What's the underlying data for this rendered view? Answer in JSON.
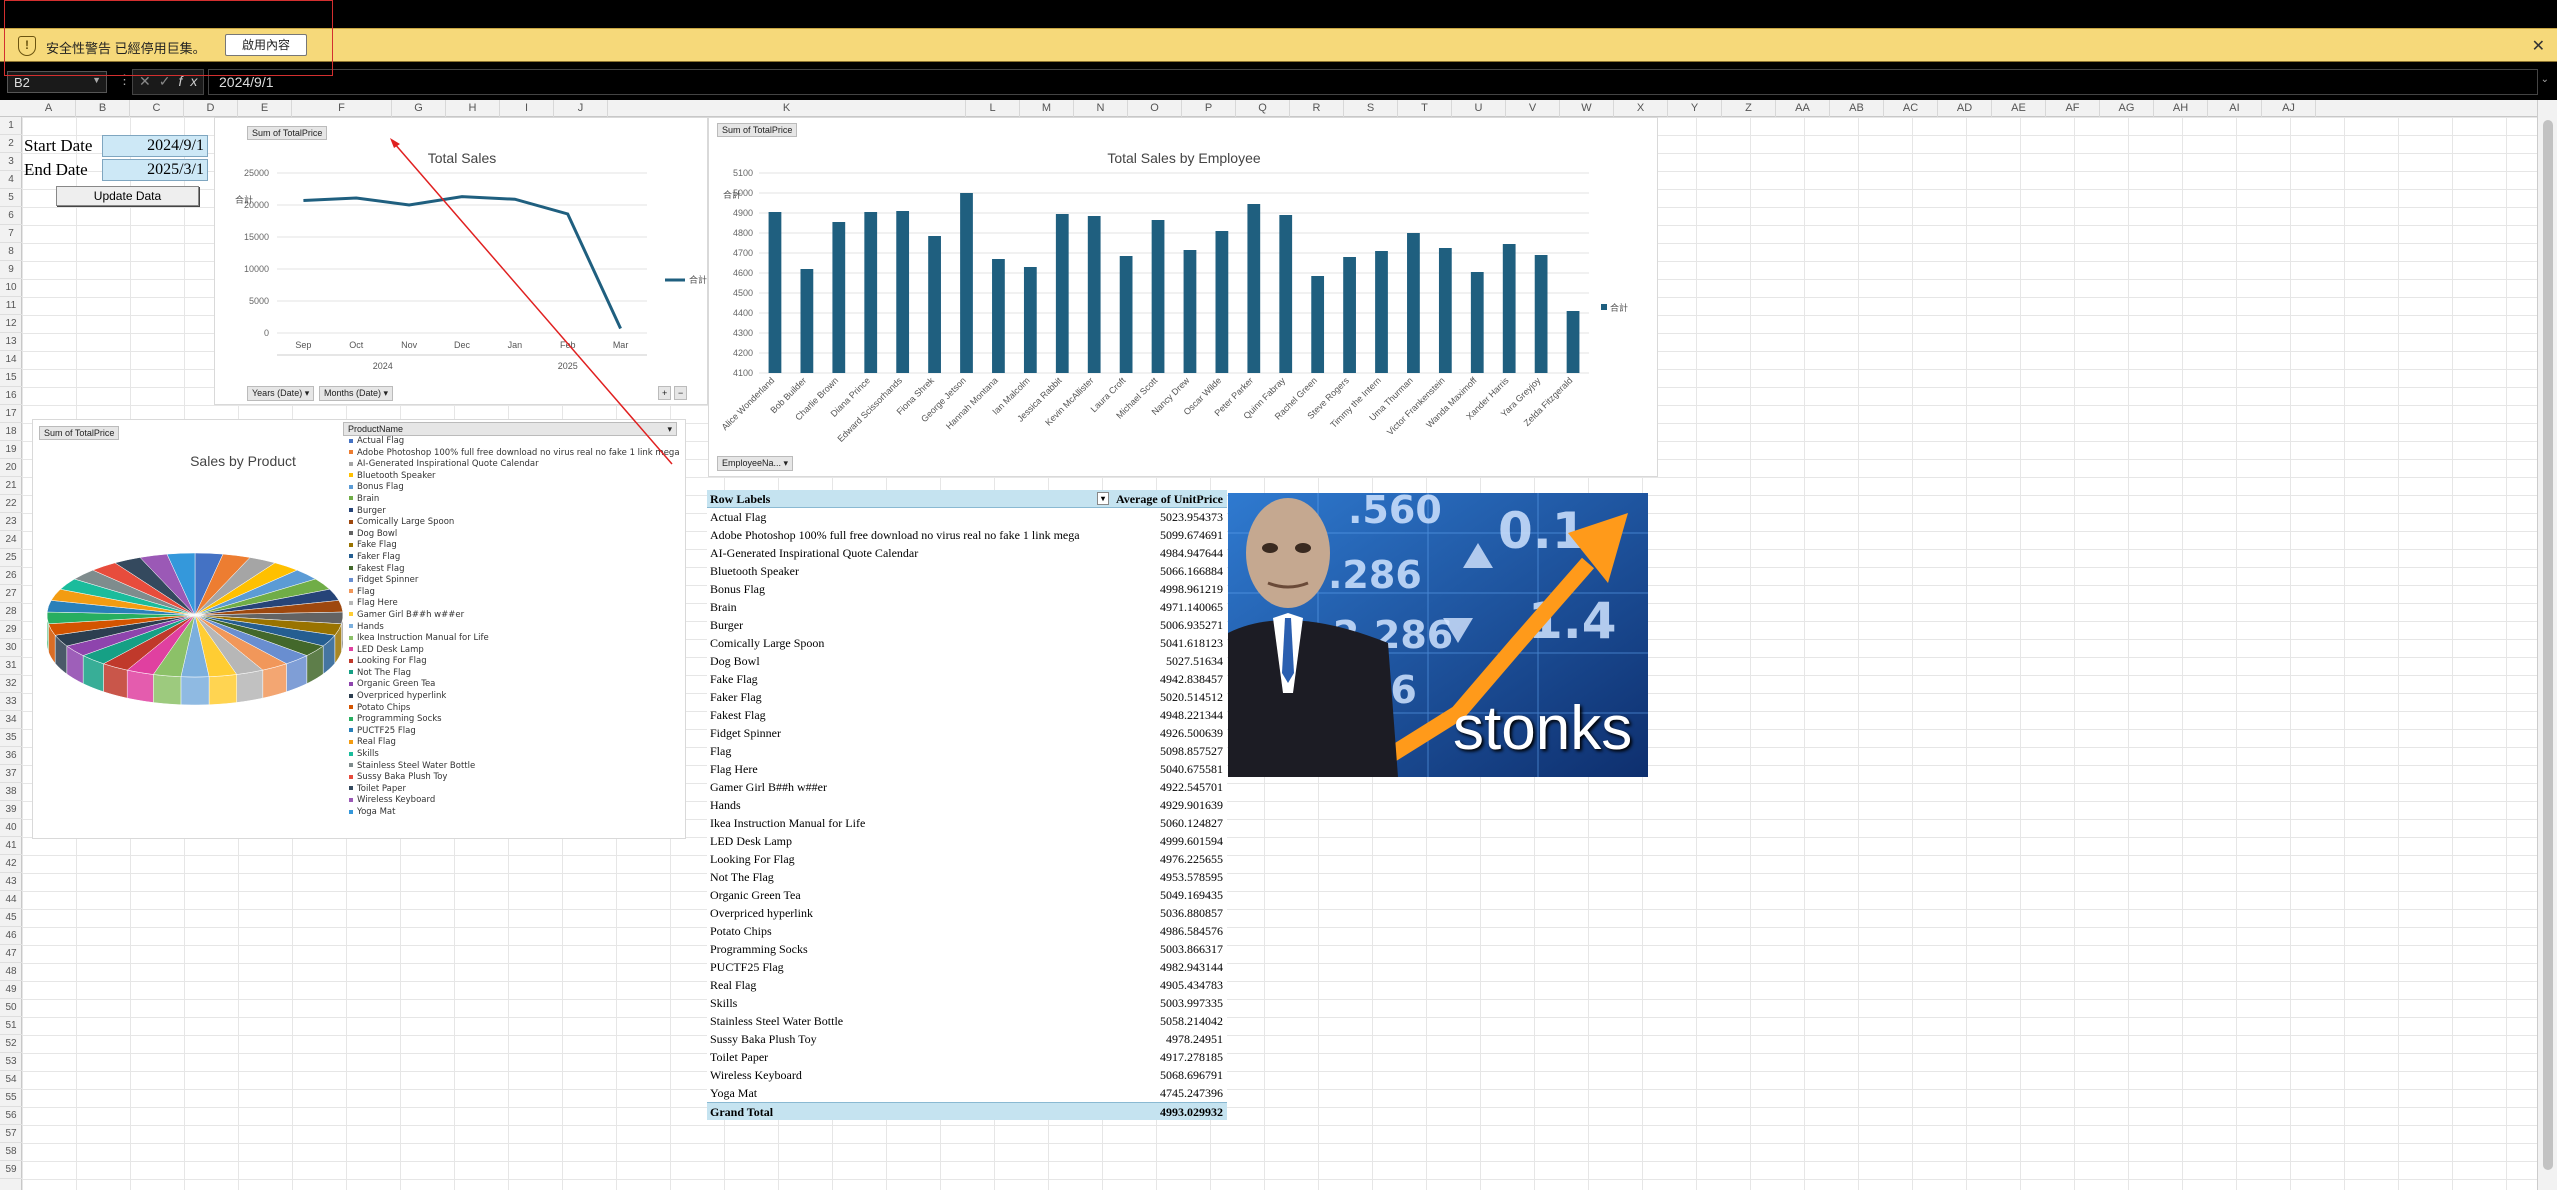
{
  "security_bar": {
    "message": "安全性警告 已經停用巨集。",
    "enable_button": "啟用內容",
    "icon": "shield-icon"
  },
  "formula_bar": {
    "name_box": "B2",
    "formula": "2024/9/1",
    "fx_label": "fx"
  },
  "columns": [
    "A",
    "B",
    "C",
    "D",
    "E",
    "F",
    "G",
    "H",
    "I",
    "J",
    "K",
    "L",
    "M",
    "N",
    "O",
    "P",
    "Q",
    "R",
    "S",
    "T",
    "U",
    "V",
    "W",
    "X",
    "Y",
    "Z",
    "AA",
    "AB",
    "AC",
    "AD",
    "AE",
    "AF",
    "AG",
    "AH",
    "AI",
    "AJ"
  ],
  "rows": [
    "1",
    "2",
    "3",
    "4",
    "5",
    "6",
    "7",
    "8",
    "9",
    "10",
    "11",
    "12",
    "13",
    "14",
    "15",
    "16",
    "17",
    "18",
    "19",
    "20",
    "21",
    "22",
    "23",
    "24",
    "25",
    "26",
    "27",
    "28",
    "29",
    "30",
    "31",
    "32",
    "33",
    "34",
    "35",
    "36",
    "37",
    "38",
    "39",
    "40",
    "41",
    "42",
    "43",
    "44",
    "45",
    "46",
    "47",
    "48",
    "49",
    "50",
    "51",
    "52",
    "53",
    "54",
    "55",
    "56",
    "57",
    "58",
    "59"
  ],
  "cells": {
    "start_label": "Start Date",
    "start_value": "2024/9/1",
    "end_label": "End Date",
    "end_value": "2025/3/1",
    "update_button": "Update Data"
  },
  "total_sales_chart": {
    "field_button": "Sum of TotalPrice",
    "legend": "合計",
    "year_filter": "Years (Date)",
    "month_filter": "Months (Date)"
  },
  "employee_chart": {
    "field_button": "Sum of TotalPrice",
    "legend": "合計",
    "filter_button": "EmployeeNa..."
  },
  "product_chart": {
    "field_button": "Sum of TotalPrice",
    "legend_header": "ProductName"
  },
  "pivot": {
    "header_row_labels": "Row Labels",
    "header_value": "Average of UnitPrice",
    "rows": [
      [
        "Actual Flag",
        "5023.954373"
      ],
      [
        "Adobe Photoshop 100% full free download no virus real no fake 1 link mega",
        "5099.674691"
      ],
      [
        "AI-Generated Inspirational Quote Calendar",
        "4984.947644"
      ],
      [
        "Bluetooth Speaker",
        "5066.166884"
      ],
      [
        "Bonus Flag",
        "4998.961219"
      ],
      [
        "Brain",
        "4971.140065"
      ],
      [
        "Burger",
        "5006.935271"
      ],
      [
        "Comically Large Spoon",
        "5041.618123"
      ],
      [
        "Dog Bowl",
        "5027.51634"
      ],
      [
        "Fake Flag",
        "4942.838457"
      ],
      [
        "Faker Flag",
        "5020.514512"
      ],
      [
        "Fakest Flag",
        "4948.221344"
      ],
      [
        "Fidget Spinner",
        "4926.500639"
      ],
      [
        "Flag",
        "5098.857527"
      ],
      [
        "Flag Here",
        "5040.675581"
      ],
      [
        "Gamer Girl B##h w##er",
        "4922.545701"
      ],
      [
        "Hands",
        "4929.901639"
      ],
      [
        "Ikea Instruction Manual for Life",
        "5060.124827"
      ],
      [
        "LED Desk Lamp",
        "4999.601594"
      ],
      [
        "Looking For Flag",
        "4976.225655"
      ],
      [
        "Not The Flag",
        "4953.578595"
      ],
      [
        "Organic Green Tea",
        "5049.169435"
      ],
      [
        "Overpriced hyperlink",
        "5036.880857"
      ],
      [
        "Potato Chips",
        "4986.584576"
      ],
      [
        "Programming Socks",
        "5003.866317"
      ],
      [
        "PUCTF25 Flag",
        "4982.943144"
      ],
      [
        "Real Flag",
        "4905.434783"
      ],
      [
        "Skills",
        "5003.997335"
      ],
      [
        "Stainless Steel Water Bottle",
        "5058.214042"
      ],
      [
        "Sussy Baka Plush Toy",
        "4978.24951"
      ],
      [
        "Toilet Paper",
        "4917.278185"
      ],
      [
        "Wireless Keyboard",
        "5068.696791"
      ],
      [
        "Yoga Mat",
        "4745.247396"
      ]
    ],
    "grand_total_label": "Grand Total",
    "grand_total_value": "4993.029932"
  },
  "stonks_image": {
    "caption": "stonks"
  },
  "chart_data": [
    {
      "type": "line",
      "title": "Total Sales",
      "ylabel": "合計",
      "categories": [
        "Sep",
        "Oct",
        "Nov",
        "Dec",
        "Jan",
        "Feb",
        "Mar"
      ],
      "year_groups": [
        {
          "label": "2024",
          "span": [
            "Sep",
            "Dec"
          ]
        },
        {
          "label": "2025",
          "span": [
            "Jan",
            "Mar"
          ]
        }
      ],
      "series": [
        {
          "name": "合計",
          "values": [
            20700,
            21100,
            20000,
            21300,
            20900,
            18600,
            700
          ]
        }
      ],
      "ylim": [
        0,
        25000
      ],
      "yticks": [
        0,
        5000,
        10000,
        15000,
        20000,
        25000
      ],
      "color": "#1f5f7f"
    },
    {
      "type": "bar",
      "title": "Total Sales by Employee",
      "ylabel": "合計",
      "categories": [
        "Alice Wonderland",
        "Bob Builder",
        "Charlie Brown",
        "Diana Prince",
        "Edward Scissorhands",
        "Fiona Shrek",
        "George Jetson",
        "Hannah Montana",
        "Ian Malcolm",
        "Jessica Rabbit",
        "Kevin McAllister",
        "Laura Croft",
        "Michael Scott",
        "Nancy Drew",
        "Oscar Wilde",
        "Peter Parker",
        "Quinn Fabray",
        "Rachel Green",
        "Steve Rogers",
        "Timmy the Intern",
        "Uma Thurman",
        "Victor Frankenstein",
        "Wanda Maximoff",
        "Xander Harris",
        "Yara Greyjoy",
        "Zelda Fitzgerald"
      ],
      "series": [
        {
          "name": "合計",
          "values": [
            4905,
            4620,
            4855,
            4905,
            4910,
            4785,
            5000,
            4670,
            4630,
            4895,
            4885,
            4685,
            4865,
            4715,
            4810,
            4945,
            4890,
            4585,
            4680,
            4710,
            4800,
            4725,
            4605,
            4745,
            4690,
            4410
          ]
        }
      ],
      "ylim": [
        4100,
        5100
      ],
      "yticks": [
        4100,
        4200,
        4300,
        4400,
        4500,
        4600,
        4700,
        4800,
        4900,
        5000,
        5100
      ],
      "color": "#1f5f7f"
    },
    {
      "type": "pie",
      "title": "Sales by Product",
      "categories": [
        "Actual Flag",
        "Adobe Photoshop 100% full free download no virus real no fake 1 link mega",
        "AI-Generated Inspirational Quote Calendar",
        "Bluetooth Speaker",
        "Bonus Flag",
        "Brain",
        "Burger",
        "Comically Large Spoon",
        "Dog Bowl",
        "Fake Flag",
        "Faker Flag",
        "Fakest Flag",
        "Fidget Spinner",
        "Flag",
        "Flag Here",
        "Gamer Girl B##h w##er",
        "Hands",
        "Ikea Instruction Manual for Life",
        "LED Desk Lamp",
        "Looking For Flag",
        "Not The Flag",
        "Organic Green Tea",
        "Overpriced hyperlink",
        "Potato Chips",
        "Programming Socks",
        "PUCTF25 Flag",
        "Real Flag",
        "Skills",
        "Stainless Steel Water Bottle",
        "Sussy Baka Plush Toy",
        "Toilet Paper",
        "Wireless Keyboard",
        "Yoga Mat"
      ],
      "values": [
        1,
        1,
        1,
        1,
        1,
        1,
        1,
        1,
        1,
        1,
        1,
        1,
        1,
        1,
        1,
        1,
        1,
        1,
        1,
        1,
        1,
        1,
        1,
        1,
        1,
        1,
        1,
        1,
        1,
        1,
        1,
        1,
        1
      ],
      "colors": [
        "#4472c4",
        "#ed7d31",
        "#a5a5a5",
        "#ffc000",
        "#5b9bd5",
        "#70ad47",
        "#264478",
        "#9e480e",
        "#636363",
        "#997300",
        "#255e91",
        "#43682b",
        "#698ed0",
        "#f1975a",
        "#b7b7b7",
        "#ffcd33",
        "#7cafdd",
        "#8cc168",
        "#e040a0",
        "#c0392b",
        "#16a085",
        "#8e44ad",
        "#2c3e50",
        "#d35400",
        "#27ae60",
        "#2980b9",
        "#f39c12",
        "#1abc9c",
        "#7f8c8d",
        "#e74c3c",
        "#34495e",
        "#9b59b6",
        "#3498db"
      ]
    }
  ]
}
